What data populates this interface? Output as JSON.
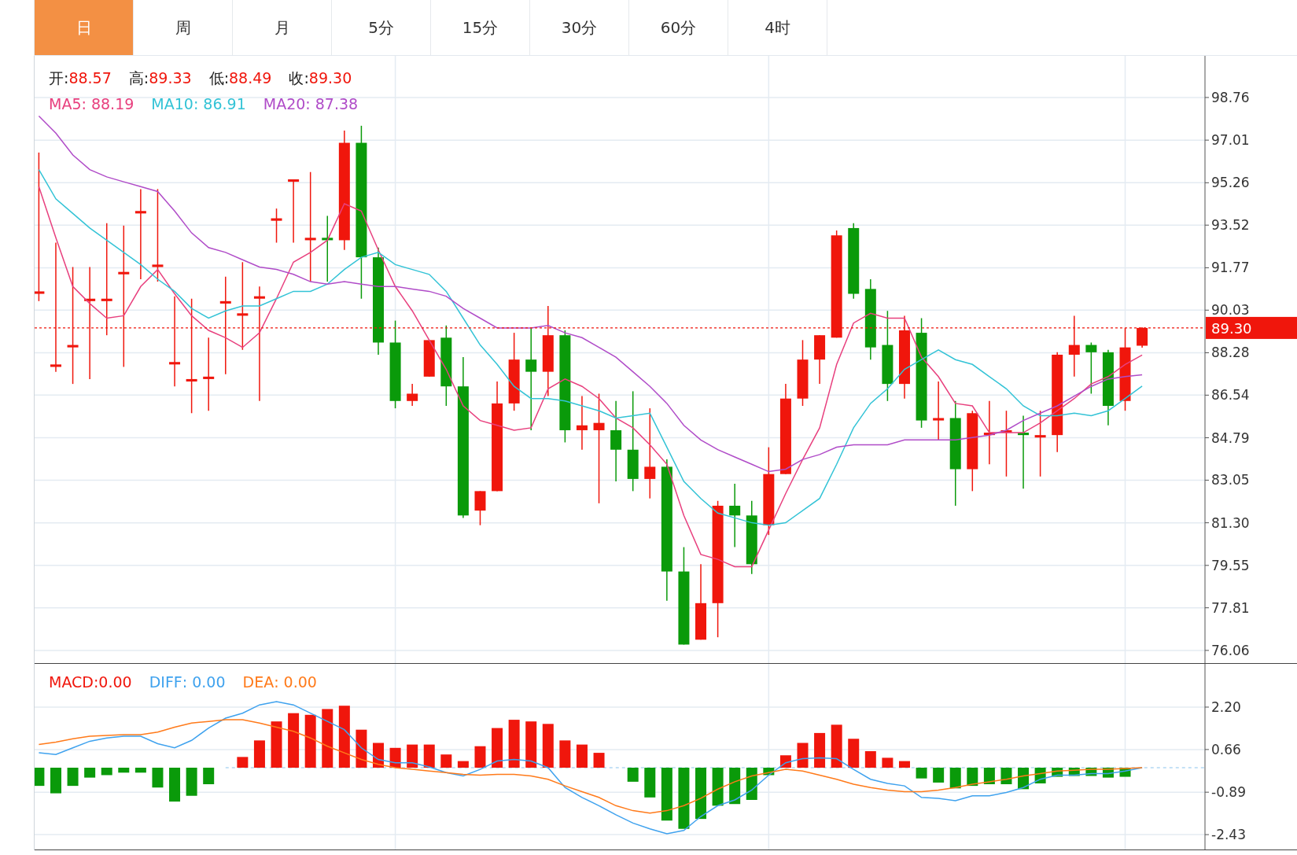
{
  "tabs": [
    {
      "label": "日",
      "selected": true
    },
    {
      "label": "周",
      "selected": false
    },
    {
      "label": "月",
      "selected": false
    },
    {
      "label": "5分",
      "selected": false
    },
    {
      "label": "15分",
      "selected": false
    },
    {
      "label": "30分",
      "selected": false
    },
    {
      "label": "60分",
      "selected": false
    },
    {
      "label": "4时",
      "selected": false
    }
  ],
  "price_chart": {
    "ohlc_legend": [
      {
        "label": "开:",
        "value": "88.57"
      },
      {
        "label": "高:",
        "value": "89.33"
      },
      {
        "label": "低:",
        "value": "88.49"
      },
      {
        "label": "收:",
        "value": "89.30"
      }
    ],
    "ma_legend": [
      {
        "value": ": 88.19"
      },
      {
        "value": ": 86.91"
      },
      {
        "value": ": 87.38"
      }
    ],
    "chart_data": {
      "type": "candlestick",
      "grid": true,
      "ylim": [
        75.54,
        100.47
      ],
      "yticks": [
        98.76,
        97.01,
        95.26,
        93.52,
        91.77,
        90.03,
        88.28,
        86.54,
        84.79,
        83.05,
        {
          "value": 81.3,
          "label": "81.30"
        },
        79.55,
        77.81,
        76.06
      ],
      "ref_lines": [
        {
          "axis": "y",
          "value": 89.3,
          "label": "89.30",
          "color": "#f0160c"
        }
      ],
      "ohlc": [
        [
          90.7,
          96.5,
          90.4,
          90.8
        ],
        [
          87.7,
          92.8,
          87.5,
          87.8
        ],
        [
          88.5,
          91.8,
          87.0,
          88.6
        ],
        [
          90.4,
          91.8,
          87.2,
          90.5
        ],
        [
          90.4,
          93.6,
          89.0,
          90.5
        ],
        [
          91.5,
          93.5,
          87.7,
          91.6
        ],
        [
          94.0,
          95.0,
          91.3,
          94.1
        ],
        [
          91.8,
          95.0,
          91.2,
          91.9
        ],
        [
          87.8,
          90.6,
          86.9,
          87.9
        ],
        [
          87.1,
          90.5,
          85.8,
          87.2
        ],
        [
          87.2,
          88.9,
          85.9,
          87.3
        ],
        [
          90.3,
          91.4,
          87.4,
          90.4
        ],
        [
          89.8,
          92.0,
          88.4,
          89.9
        ],
        [
          90.5,
          91.0,
          86.3,
          90.6
        ],
        [
          93.7,
          94.2,
          92.8,
          93.8
        ],
        [
          95.3,
          95.4,
          92.8,
          95.4
        ],
        [
          92.9,
          95.7,
          91.2,
          93.0
        ],
        [
          93.0,
          93.9,
          91.2,
          92.9
        ],
        [
          92.9,
          97.4,
          92.5,
          96.9
        ],
        [
          96.9,
          97.6,
          90.5,
          92.2
        ],
        [
          92.2,
          92.6,
          88.2,
          88.7
        ],
        [
          88.7,
          89.6,
          86.0,
          86.3
        ],
        [
          86.3,
          87.0,
          86.1,
          86.6
        ],
        [
          87.3,
          88.8,
          87.3,
          88.8
        ],
        [
          88.9,
          89.4,
          86.1,
          86.9
        ],
        [
          86.9,
          88.1,
          81.5,
          81.6
        ],
        [
          81.8,
          82.6,
          81.2,
          82.6
        ],
        [
          82.6,
          87.1,
          82.6,
          86.2
        ],
        [
          86.2,
          89.1,
          85.9,
          88.0
        ],
        [
          88.0,
          89.3,
          85.1,
          87.5
        ],
        [
          87.5,
          90.2,
          86.5,
          89.0
        ],
        [
          89.0,
          89.2,
          84.6,
          85.1
        ],
        [
          85.1,
          86.5,
          84.3,
          85.3
        ],
        [
          85.1,
          86.6,
          82.1,
          85.4
        ],
        [
          85.1,
          86.3,
          83.0,
          84.3
        ],
        [
          84.3,
          86.7,
          82.6,
          83.1
        ],
        [
          83.1,
          86.0,
          82.3,
          83.6
        ],
        [
          83.6,
          83.9,
          78.1,
          79.3
        ],
        [
          79.3,
          80.3,
          76.3,
          76.3
        ],
        [
          76.5,
          79.6,
          76.5,
          78.0
        ],
        [
          78.0,
          82.2,
          76.6,
          82.0
        ],
        [
          82.0,
          82.9,
          80.3,
          81.6
        ],
        [
          81.6,
          82.2,
          79.2,
          79.6
        ],
        [
          81.2,
          84.4,
          80.8,
          83.3
        ],
        [
          83.3,
          87.0,
          83.3,
          86.4
        ],
        [
          86.4,
          88.8,
          86.1,
          88.0
        ],
        [
          88.0,
          89.0,
          87.0,
          89.0
        ],
        [
          88.9,
          93.3,
          88.9,
          93.1
        ],
        [
          93.4,
          93.6,
          90.5,
          90.7
        ],
        [
          90.9,
          91.3,
          88.0,
          88.5
        ],
        [
          88.6,
          90.0,
          86.3,
          87.0
        ],
        [
          87.0,
          89.8,
          86.4,
          89.2
        ],
        [
          89.1,
          89.7,
          85.2,
          85.5
        ],
        [
          85.5,
          87.1,
          84.7,
          85.6
        ],
        [
          85.6,
          86.3,
          82.0,
          83.5
        ],
        [
          83.5,
          85.9,
          82.6,
          85.8
        ],
        [
          84.9,
          86.3,
          83.7,
          85.0
        ],
        [
          85.0,
          85.9,
          83.2,
          85.1
        ],
        [
          85.0,
          85.7,
          82.7,
          84.9
        ],
        [
          84.8,
          85.9,
          83.2,
          84.9
        ],
        [
          84.9,
          88.3,
          84.2,
          88.2
        ],
        [
          88.2,
          89.8,
          87.3,
          88.6
        ],
        [
          88.6,
          88.7,
          86.6,
          88.3
        ],
        [
          88.3,
          88.4,
          85.3,
          86.1
        ],
        [
          86.3,
          89.3,
          85.9,
          88.5
        ],
        [
          88.57,
          89.33,
          88.49,
          89.3
        ]
      ],
      "series": [
        {
          "name": "MA5",
          "type": "line",
          "color": "#e8407e",
          "values": [
            95.1,
            93.0,
            91.0,
            90.3,
            89.7,
            89.8,
            91.0,
            91.7,
            90.7,
            89.8,
            89.2,
            88.9,
            88.5,
            89.1,
            90.5,
            92.0,
            92.4,
            92.9,
            94.4,
            94.1,
            92.5,
            91.0,
            90.0,
            88.8,
            87.6,
            86.1,
            85.5,
            85.3,
            85.1,
            85.2,
            86.8,
            87.2,
            86.9,
            86.4,
            85.6,
            85.2,
            84.5,
            83.7,
            81.6,
            80.0,
            79.8,
            79.5,
            79.5,
            81.0,
            82.5,
            83.9,
            85.2,
            87.8,
            89.5,
            89.9,
            89.7,
            89.7,
            88.1,
            87.3,
            86.2,
            86.1,
            85.0,
            85.0,
            85.0,
            85.4,
            85.9,
            86.4,
            87.0,
            87.3,
            87.8,
            88.19
          ]
        },
        {
          "name": "MA10",
          "type": "line",
          "color": "#33c3d6",
          "values": [
            95.8,
            94.6,
            94.0,
            93.4,
            92.9,
            92.4,
            91.9,
            91.3,
            90.8,
            90.1,
            89.7,
            90.0,
            90.2,
            90.2,
            90.5,
            90.8,
            90.8,
            91.1,
            91.7,
            92.2,
            92.4,
            91.9,
            91.7,
            91.5,
            90.8,
            89.7,
            88.6,
            87.8,
            86.9,
            86.4,
            86.4,
            86.3,
            86.1,
            85.9,
            85.6,
            85.7,
            85.8,
            84.4,
            83.0,
            82.3,
            81.7,
            81.5,
            81.3,
            81.2,
            81.3,
            81.8,
            82.3,
            83.7,
            85.2,
            86.2,
            86.8,
            87.6,
            88.0,
            88.4,
            88.0,
            87.8,
            87.3,
            86.8,
            86.1,
            85.7,
            85.7,
            85.8,
            85.7,
            85.9,
            86.4,
            86.91
          ]
        },
        {
          "name": "MA20",
          "type": "line",
          "color": "#b04cc8",
          "values": [
            98.0,
            97.3,
            96.4,
            95.8,
            95.5,
            95.3,
            95.1,
            94.9,
            94.1,
            93.2,
            92.6,
            92.4,
            92.1,
            91.8,
            91.7,
            91.5,
            91.2,
            91.1,
            91.2,
            91.1,
            91.0,
            91.0,
            90.9,
            90.8,
            90.6,
            90.1,
            89.7,
            89.3,
            89.3,
            89.3,
            89.4,
            89.1,
            88.9,
            88.5,
            88.1,
            87.5,
            86.9,
            86.2,
            85.3,
            84.7,
            84.3,
            84.0,
            83.7,
            83.4,
            83.5,
            83.9,
            84.1,
            84.4,
            84.5,
            84.5,
            84.5,
            84.7,
            84.7,
            84.7,
            84.7,
            84.8,
            84.9,
            85.1,
            85.5,
            85.8,
            86.1,
            86.5,
            86.9,
            87.2,
            87.3,
            87.38
          ]
        }
      ]
    }
  },
  "macd_chart": {
    "macd_legend": {
      "label": "MACD:",
      "value": "0.00"
    },
    "line_legend": [
      {
        "value": ": 0.00"
      },
      {
        "value": ": 0.00"
      }
    ],
    "chart_data": {
      "type": "bar",
      "grid": true,
      "ylim": [
        -2.97,
        3.77
      ],
      "yticks": [
        {
          "value": 2.2,
          "label": "2.20"
        },
        0.66,
        -0.89,
        -2.43
      ],
      "ref_lines": [
        {
          "axis": "y",
          "value": 0,
          "color": "#8cc4ee"
        }
      ],
      "colors": [
        "#0a9a0a",
        "#0a9a0a",
        "#0a9a0a",
        "#0a9a0a",
        "#0a9a0a",
        "#0a9a0a",
        "#0a9a0a",
        "#0a9a0a",
        "#0a9a0a",
        "#0a9a0a",
        "#0a9a0a",
        null,
        "#f0160c",
        "#f0160c",
        "#f0160c",
        "#f0160c",
        "#f0160c",
        "#f0160c",
        "#f0160c",
        "#f0160c",
        "#f0160c",
        "#f0160c",
        "#f0160c",
        "#f0160c",
        "#f0160c",
        "#f0160c",
        "#f0160c",
        "#f0160c",
        "#f0160c",
        "#f0160c",
        "#f0160c",
        "#f0160c",
        "#f0160c",
        "#f0160c",
        null,
        "#0a9a0a",
        "#0a9a0a",
        "#0a9a0a",
        "#0a9a0a",
        "#0a9a0a",
        "#0a9a0a",
        "#0a9a0a",
        "#0a9a0a",
        "#0a9a0a",
        "#f0160c",
        "#f0160c",
        "#f0160c",
        "#f0160c",
        "#f0160c",
        "#f0160c",
        "#f0160c",
        "#f0160c",
        "#0a9a0a",
        "#0a9a0a",
        "#0a9a0a",
        "#0a9a0a",
        "#0a9a0a",
        "#0a9a0a",
        "#0a9a0a",
        "#0a9a0a",
        "#0a9a0a",
        "#0a9a0a",
        "#0a9a0a",
        "#0a9a0a",
        "#0a9a0a",
        null
      ],
      "values": [
        -0.66,
        -0.93,
        -0.66,
        -0.36,
        -0.27,
        -0.18,
        -0.18,
        -0.72,
        -1.23,
        -1.02,
        -0.6,
        0,
        0.39,
        0.99,
        1.68,
        1.98,
        1.92,
        2.13,
        2.25,
        1.38,
        0.9,
        0.72,
        0.84,
        0.84,
        0.48,
        0.24,
        0.78,
        1.44,
        1.74,
        1.68,
        1.59,
        0.99,
        0.84,
        0.54,
        0,
        -0.51,
        -1.08,
        -1.92,
        -2.22,
        -1.86,
        -1.38,
        -1.32,
        -1.17,
        -0.27,
        0.45,
        0.9,
        1.26,
        1.56,
        1.05,
        0.6,
        0.36,
        0.24,
        -0.39,
        -0.54,
        -0.75,
        -0.66,
        -0.6,
        -0.6,
        -0.78,
        -0.57,
        -0.33,
        -0.3,
        -0.3,
        -0.36,
        -0.33,
        0
      ],
      "series": [
        {
          "name": "DIFF",
          "type": "line",
          "color": "#3fa2ee",
          "values": [
            0.54,
            0.48,
            0.72,
            0.96,
            1.08,
            1.14,
            1.14,
            0.87,
            0.72,
            0.99,
            1.44,
            1.8,
            1.98,
            2.28,
            2.4,
            2.28,
            1.98,
            1.68,
            1.38,
            0.72,
            0.3,
            0.18,
            0.18,
            0.03,
            -0.18,
            -0.3,
            -0.06,
            0.24,
            0.3,
            0.24,
            0,
            -0.72,
            -1.08,
            -1.38,
            -1.71,
            -2.01,
            -2.22,
            -2.4,
            -2.28,
            -1.77,
            -1.38,
            -1.17,
            -0.81,
            -0.27,
            0.18,
            0.33,
            0.36,
            0.33,
            -0.06,
            -0.42,
            -0.57,
            -0.66,
            -1.08,
            -1.11,
            -1.2,
            -1.02,
            -1.02,
            -0.9,
            -0.72,
            -0.42,
            -0.27,
            -0.27,
            -0.21,
            -0.21,
            -0.12,
            0
          ]
        },
        {
          "name": "DEA",
          "type": "line",
          "color": "#ff7a1a",
          "values": [
            0.84,
            0.93,
            1.05,
            1.14,
            1.17,
            1.2,
            1.2,
            1.29,
            1.47,
            1.62,
            1.68,
            1.74,
            1.74,
            1.62,
            1.47,
            1.32,
            1.08,
            0.78,
            0.54,
            0.3,
            0.12,
            0,
            -0.06,
            -0.12,
            -0.18,
            -0.24,
            -0.27,
            -0.24,
            -0.24,
            -0.3,
            -0.42,
            -0.66,
            -0.87,
            -1.08,
            -1.38,
            -1.56,
            -1.65,
            -1.56,
            -1.38,
            -1.11,
            -0.78,
            -0.51,
            -0.3,
            -0.18,
            -0.06,
            -0.12,
            -0.27,
            -0.42,
            -0.6,
            -0.72,
            -0.81,
            -0.87,
            -0.87,
            -0.81,
            -0.72,
            -0.6,
            -0.51,
            -0.42,
            -0.3,
            -0.21,
            -0.12,
            -0.09,
            -0.06,
            -0.06,
            -0.03,
            0
          ]
        }
      ]
    }
  }
}
